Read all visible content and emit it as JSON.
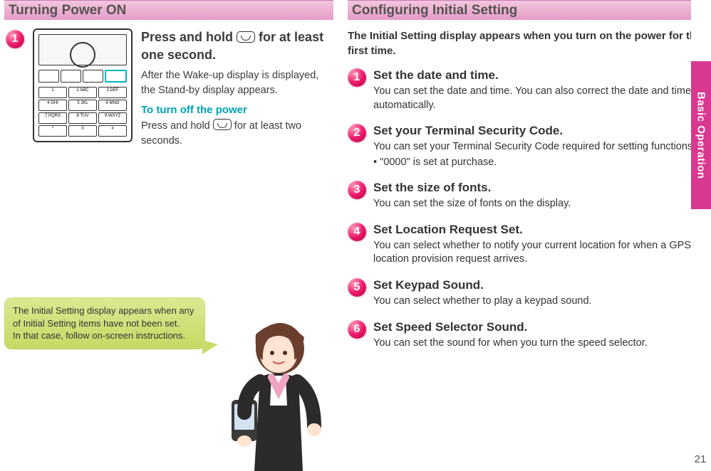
{
  "left": {
    "header": "Turning Power ON",
    "step1_num": "1",
    "lead_a": "Press and hold ",
    "lead_b": " for at least one second.",
    "desc": "After the Wake-up display is displayed, the Stand-by display appears.",
    "turnoff_label": "To turn off the power",
    "turnoff_a": "Press and hold ",
    "turnoff_b": " for at least two seconds.",
    "callout": "The Initial Setting display appears when any of Initial Setting items have not been set.\nIn that case, follow on-screen instructions."
  },
  "right": {
    "header": "Configuring Initial Setting",
    "intro": "The Initial Setting display appears when you turn on the power for the first time.",
    "steps": [
      {
        "n": "1",
        "title": "Set the date and time.",
        "desc": "You can set the date and time. You can also correct the date and time automatically."
      },
      {
        "n": "2",
        "title": "Set your Terminal Security Code.",
        "desc": "You can set your Terminal Security Code required for setting functions.",
        "bullet": "• \"0000\" is set at purchase."
      },
      {
        "n": "3",
        "title": "Set the size of fonts.",
        "desc": "You can set the size of fonts on the display."
      },
      {
        "n": "4",
        "title": "Set Location Request Set.",
        "desc": "You can select whether to notify your current location for when a GPS location provision request arrives."
      },
      {
        "n": "5",
        "title": "Set Keypad Sound.",
        "desc": "You can select whether to play a keypad sound."
      },
      {
        "n": "6",
        "title": "Set Speed Selector Sound.",
        "desc": "You can set the sound for when you turn the speed selector."
      }
    ]
  },
  "side": {
    "tab": "Basic Operation",
    "page": "21"
  }
}
